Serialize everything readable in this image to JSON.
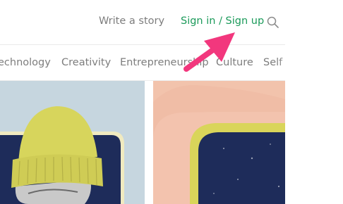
{
  "header": {
    "write_story_label": "Write a story",
    "sign_in_label": "Sign in / Sign up",
    "search_icon": "search-icon"
  },
  "nav": {
    "items": [
      "echnology",
      "Creativity",
      "Entrepreneurship",
      "Culture",
      "Self"
    ]
  },
  "annotation": {
    "arrow_icon": "pointer-arrow-icon",
    "color": "#f2377d"
  },
  "colors": {
    "accent_green": "#1b9a5a",
    "muted_text": "#7d7d7d",
    "card_left_bg": "#c6d6df",
    "card_right_bg": "#f0bda6",
    "navy": "#1e2c5a",
    "yellow": "#d9d55a"
  }
}
